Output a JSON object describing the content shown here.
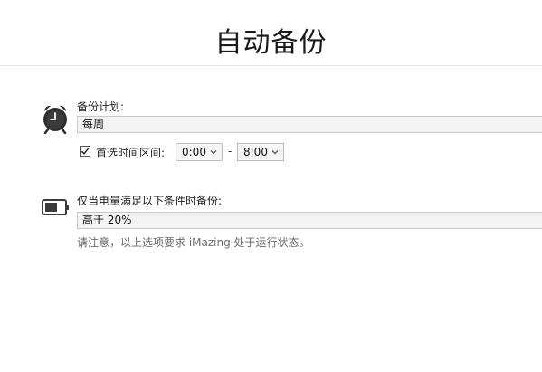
{
  "title": "自动备份",
  "schedule": {
    "label": "备份计划:",
    "value": "每周",
    "preferred_range": {
      "label": "首选时间区间:",
      "checked": true,
      "start": "0:00",
      "separator": "-",
      "end": "8:00"
    }
  },
  "power": {
    "label": "仅当电量满足以下条件时备份:",
    "value": "高于 20%",
    "note": "请注意，以上选项要求 iMazing 处于运行状态。"
  },
  "icons": {
    "schedule": "alarm-clock-icon",
    "power": "battery-icon",
    "checkbox": "checkmark-icon",
    "dropdown": "chevron-down-icon"
  }
}
